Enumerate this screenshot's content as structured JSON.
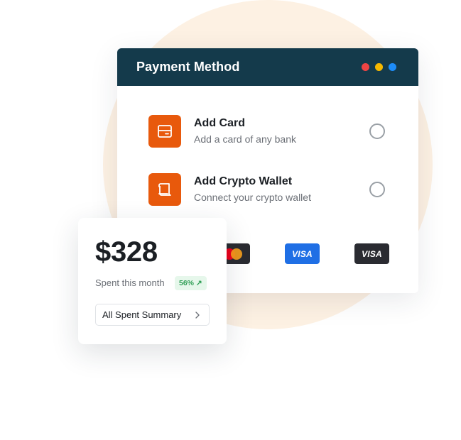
{
  "payment_window": {
    "title": "Payment Method",
    "window_dots": [
      "#ef4444",
      "#f5b800",
      "#1d8cf8"
    ],
    "options": [
      {
        "title": "Add Card",
        "subtitle": "Add a card of any bank",
        "icon": "card-icon"
      },
      {
        "title": "Add Crypto Wallet",
        "subtitle": "Connect your crypto wallet",
        "icon": "wallet-icon"
      }
    ],
    "card_logos": [
      {
        "brand": "mastercard-icon",
        "colors": [
          "#eb001b",
          "#f79e1b"
        ]
      },
      {
        "brand": "VISA",
        "background": "#1f6fe5"
      },
      {
        "brand": "VISA",
        "background": "#2a2b31"
      }
    ]
  },
  "spent_card": {
    "amount": "$328",
    "label": "Spent this month",
    "change_badge": "56% ↗",
    "summary_button": "All Spent Summary"
  },
  "colors": {
    "header": "#143a4b",
    "accent": "#e8590c",
    "background_circle": "#fdf1e3",
    "positive": "#2f9e55"
  }
}
